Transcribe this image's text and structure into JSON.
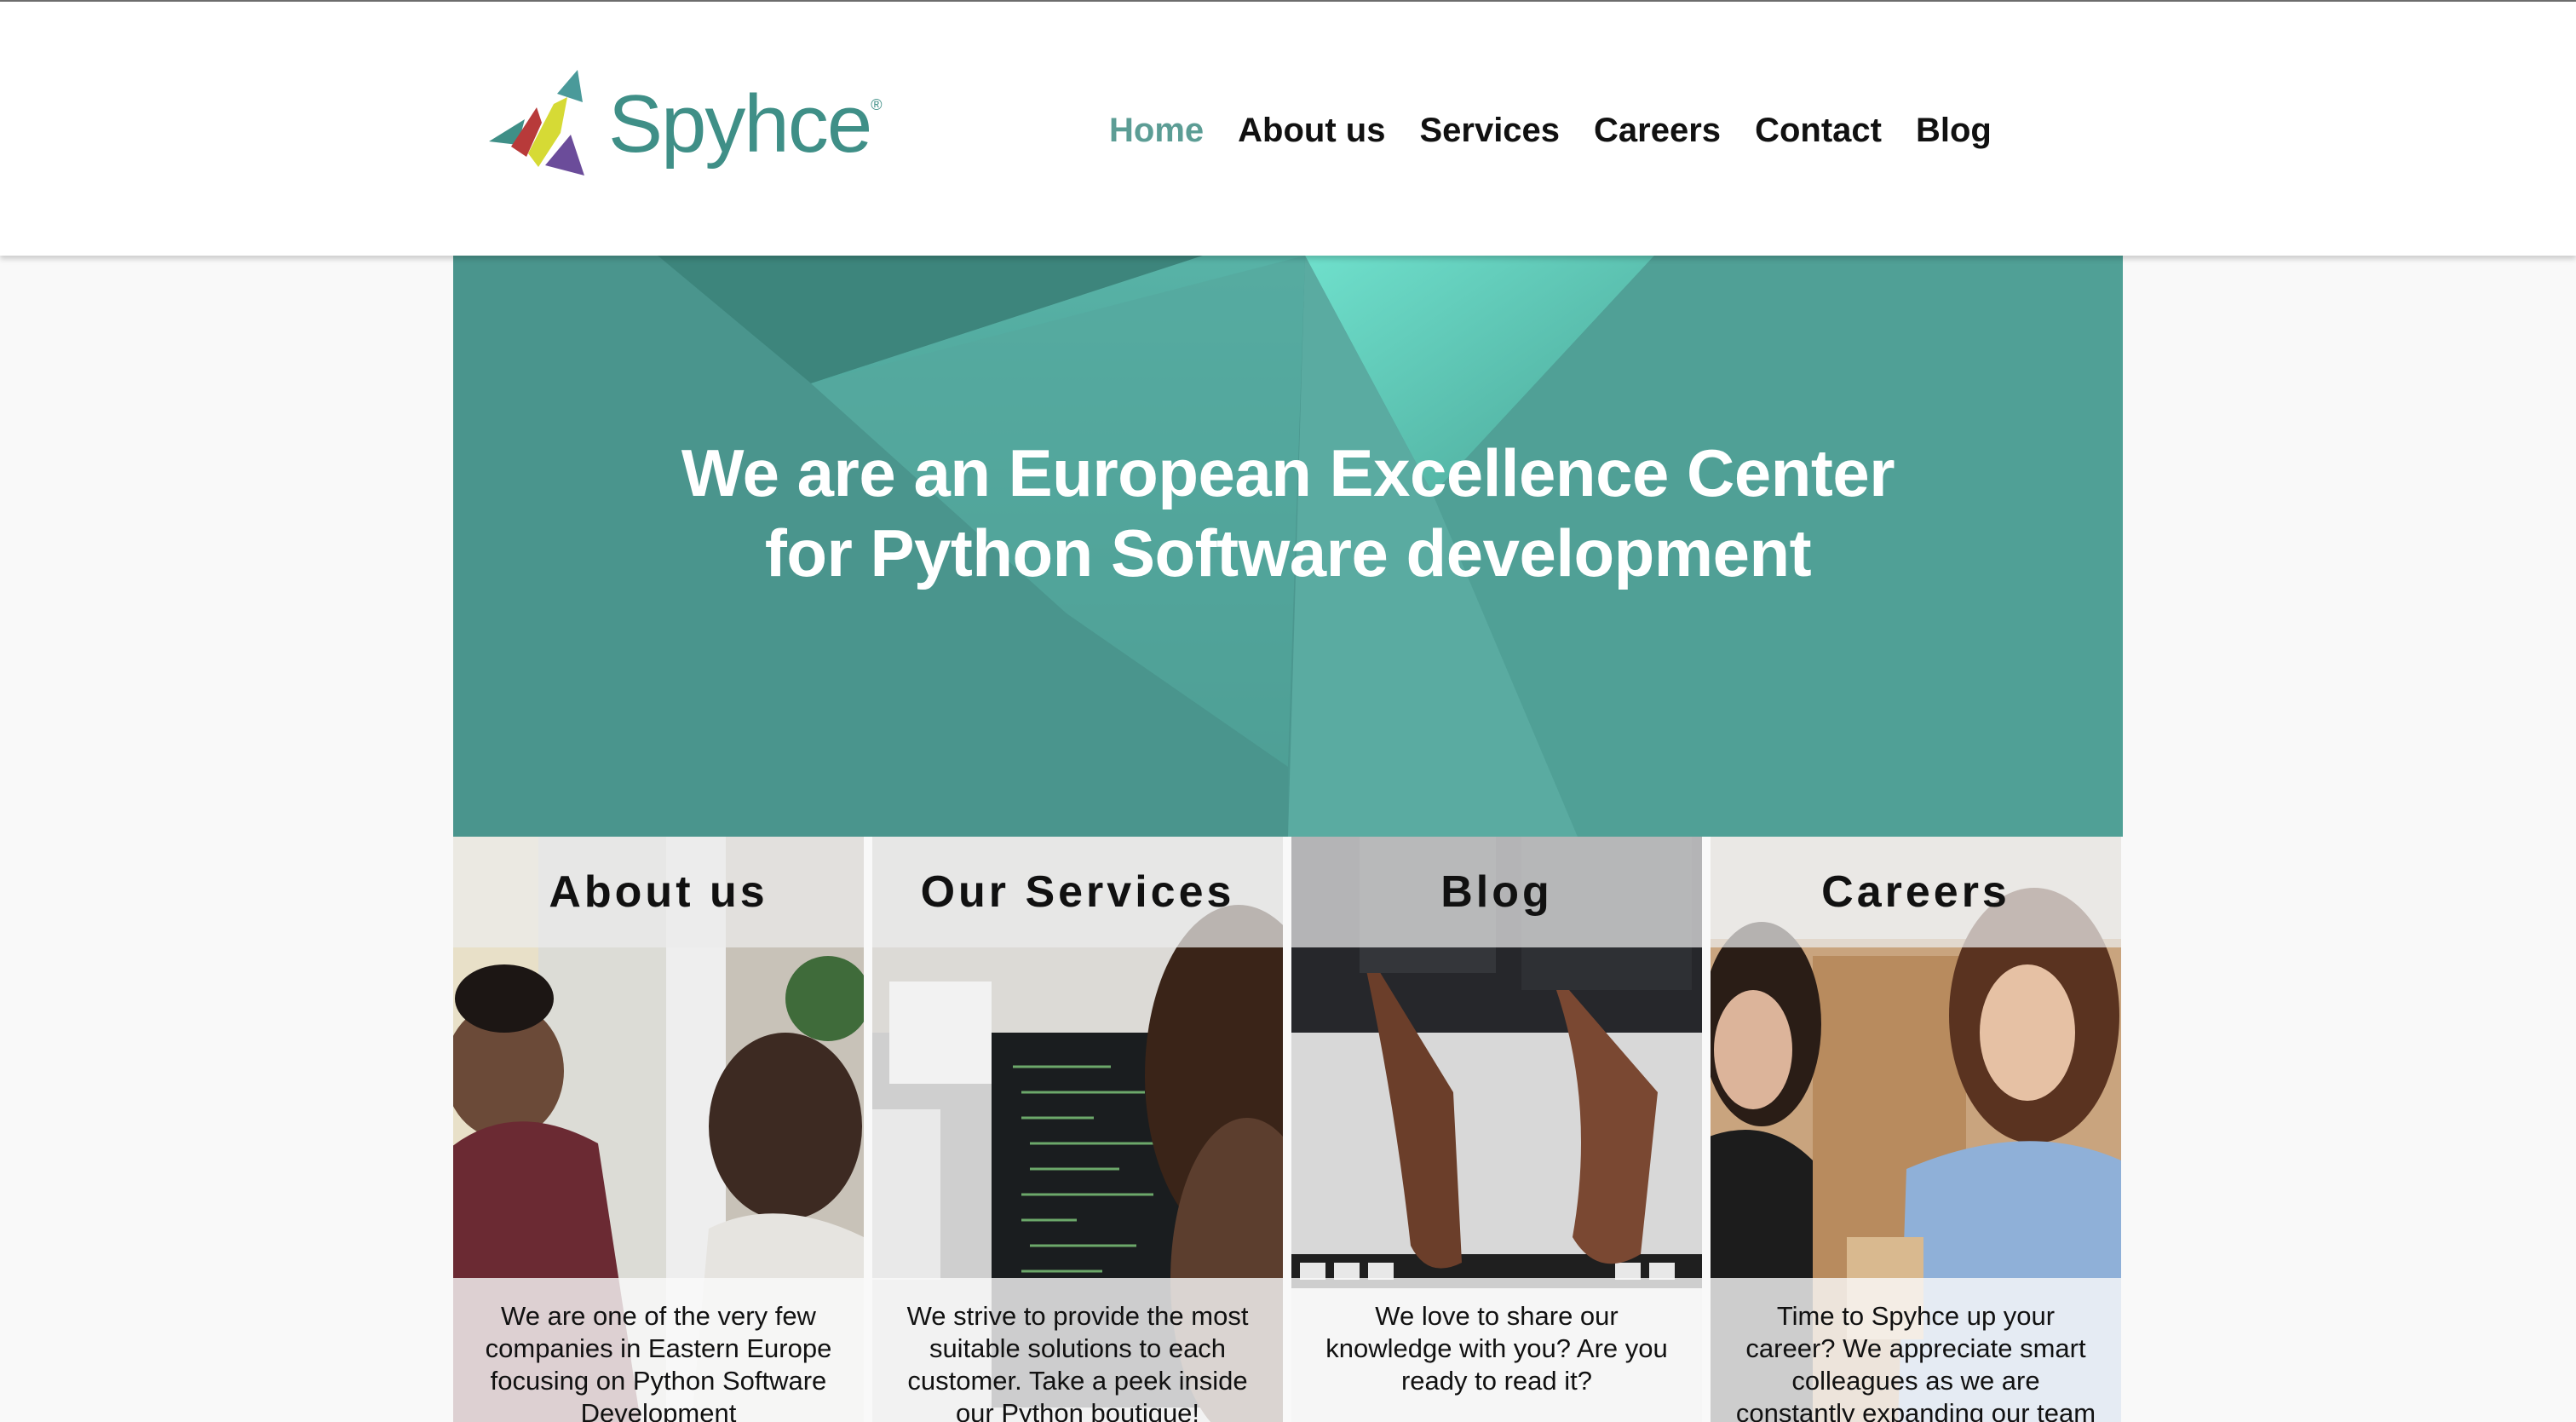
{
  "brand": {
    "name": "Spyhce",
    "mark": "®",
    "color": "#3f8f87"
  },
  "nav": {
    "items": [
      {
        "label": "Home",
        "active": true
      },
      {
        "label": "About us",
        "active": false
      },
      {
        "label": "Services",
        "active": false
      },
      {
        "label": "Careers",
        "active": false
      },
      {
        "label": "Contact",
        "active": false
      },
      {
        "label": "Blog",
        "active": false
      }
    ],
    "active_color": "#5c9d95"
  },
  "hero": {
    "line1": "We are an European Excellence Center",
    "line2": "for Python Software development",
    "color": "#4f9c93"
  },
  "cards": [
    {
      "title": "About us",
      "text": "We are one of the very few companies in Eastern Europe focusing on Python Software Development"
    },
    {
      "title": "Our Services",
      "text": "We strive to provide the most suitable solutions to each customer. Take a peek inside our Python boutique!"
    },
    {
      "title": "Blog",
      "text": "We love to share our knowledge with you? Are you ready to read it?"
    },
    {
      "title": "Careers",
      "text": "Time to Spyhce up your career? We appreciate smart colleagues as we are constantly expanding our team"
    }
  ]
}
